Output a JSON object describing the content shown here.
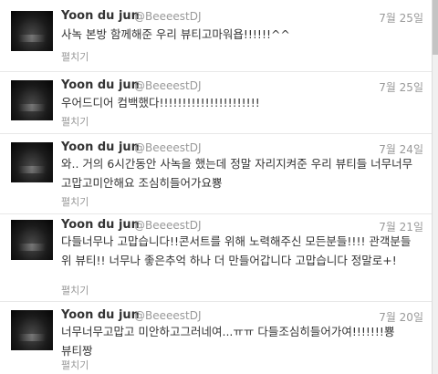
{
  "tweets": [
    {
      "name": "Yoon du jun",
      "handle": "@BeeeestDJ",
      "date": "7월 25일",
      "text": "사녹 본방 함께해준 우리 뷰티고마워욥!!!!!!^^",
      "expand": "펼치기",
      "avatar_icon": "profile-photo"
    },
    {
      "name": "Yoon du jun",
      "handle": "@BeeeestDJ",
      "date": "7월 25일",
      "text": "우어드디어 컴백했다!!!!!!!!!!!!!!!!!!!!!!",
      "expand": "펼치기",
      "avatar_icon": "profile-photo"
    },
    {
      "name": "Yoon du jun",
      "handle": "@BeeeestDJ",
      "date": "7월 24일",
      "text": "와.. 거의 6시간동안 사녹을 했는데 정말 자리지켜준 우리 뷰티들 너무너무 고맙고미안해요 조심히들어가요뿅",
      "expand": "펼치기",
      "avatar_icon": "profile-photo"
    },
    {
      "name": "Yoon du jun",
      "handle": "@BeeeestDJ",
      "date": "7월 21일",
      "text": "다들너무나 고맙습니다!!콘서트를 위해 노력해주신 모든분들!!!! 관객분들 위 뷰티!! 너무나 좋은추억 하나 더 만들어갑니다 고맙습니다 정말로+!",
      "expand": "펼치기",
      "avatar_icon": "profile-photo"
    },
    {
      "name": "Yoon du jun",
      "handle": "@BeeeestDJ",
      "date": "7월 20일",
      "text": "너무너무고맙고 미안하고그러네여...ㅠㅠ 다들조심히들어가여!!!!!!!뿅 뷰티짱",
      "expand": "펼치기",
      "avatar_icon": "profile-photo"
    }
  ]
}
